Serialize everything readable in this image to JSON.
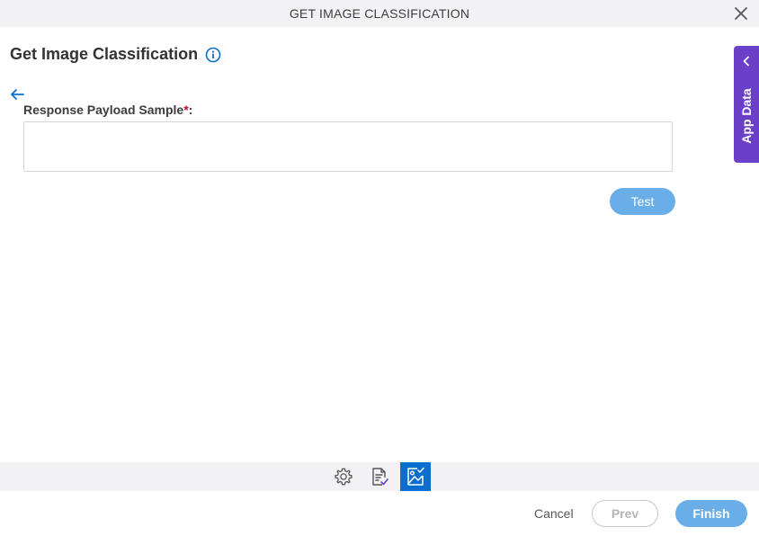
{
  "window": {
    "title": "GET IMAGE CLASSIFICATION",
    "close_icon": "close-icon"
  },
  "page": {
    "heading": "Get Image Classification",
    "info_icon": "info-icon",
    "back_icon": "arrow-left-icon"
  },
  "form": {
    "payload_label": "Response Payload Sample",
    "required_marker": "*",
    "label_suffix": ":",
    "payload_value": "",
    "test_label": "Test"
  },
  "app_data": {
    "label": "App Data",
    "chevron_icon": "chevron-left-icon"
  },
  "steps": [
    {
      "icon": "gear-icon",
      "active": false
    },
    {
      "icon": "document-check-icon",
      "active": false
    },
    {
      "icon": "image-check-icon",
      "active": true
    }
  ],
  "footer": {
    "cancel_label": "Cancel",
    "prev_label": "Prev",
    "finish_label": "Finish"
  },
  "colors": {
    "accent": "#0a6ed1",
    "button_blue": "#6aaee8",
    "app_data_purple": "#6c3fc9",
    "required_red": "#d0021b"
  }
}
